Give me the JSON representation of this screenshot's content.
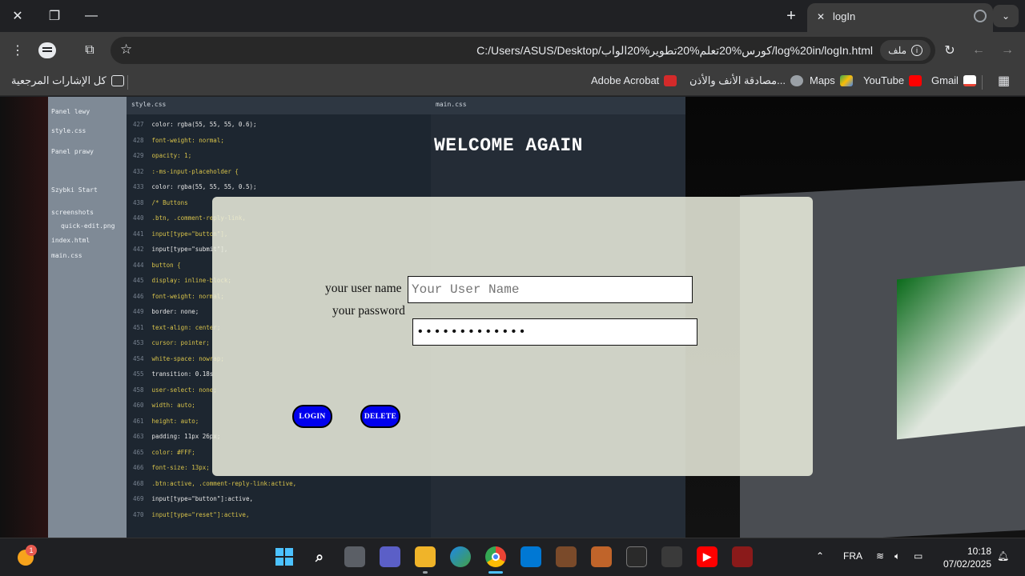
{
  "window": {
    "tab_title": "logIn",
    "new_tab_label": "+",
    "close_label": "✕",
    "maximize_label": "❐",
    "minimize_label": "—"
  },
  "toolbar": {
    "url": "C:/Users/ASUS/Desktop/كورس%20تعلم%20تطوير%20الواب/log%20in/logIn.html",
    "site_chip_label": "ملف"
  },
  "bookmarks": {
    "all_bookmarks": "كل الإشارات المرجعية",
    "items": [
      {
        "label": "Adobe Acrobat",
        "color": "#d42a2a"
      },
      {
        "label": "مصادقة الأنف والأذن...",
        "color": "#9aa0a6"
      },
      {
        "label": "Maps",
        "color": "#34a853"
      },
      {
        "label": "YouTube",
        "color": "#ff0000"
      },
      {
        "label": "Gmail",
        "color": "#ea4335"
      }
    ]
  },
  "page": {
    "heading": "WELCOME AGAIN",
    "username_label": "your user name",
    "username_placeholder": "Your User Name",
    "password_label": "your password",
    "password_value": "•••••••••••••",
    "login_button": "LOGIN",
    "delete_button": "DELETE",
    "accent_color": "#0000ee",
    "background_code": {
      "left_panel": [
        "Panel lewy",
        "style.css",
        "Panel prawy",
        "Szybki Start",
        "screenshots",
        "quick-edit.png",
        "index.html",
        "main.css"
      ],
      "file1_tab": "style.css",
      "file2_tab": "main.css",
      "lines": [
        {
          "n": "427",
          "t": "color: rgba(55, 55, 55, 0.6);"
        },
        {
          "n": "428",
          "t": "font-weight: normal;"
        },
        {
          "n": "429",
          "t": "opacity: 1;"
        },
        {
          "n": "432",
          "t": ":-ms-input-placeholder {"
        },
        {
          "n": "433",
          "t": "color: rgba(55, 55, 55, 0.5);"
        },
        {
          "n": "438",
          "t": "/* Buttons"
        },
        {
          "n": "440",
          "t": ".btn, .comment-reply-link,"
        },
        {
          "n": "441",
          "t": "input[type=\"button\"],"
        },
        {
          "n": "442",
          "t": "input[type=\"submit\"],"
        },
        {
          "n": "444",
          "t": "button {"
        },
        {
          "n": "445",
          "t": "display: inline-block;"
        },
        {
          "n": "446",
          "t": "font-weight: normal;"
        },
        {
          "n": "449",
          "t": "border: none;"
        },
        {
          "n": "451",
          "t": "text-align: center;"
        },
        {
          "n": "453",
          "t": "cursor: pointer;"
        },
        {
          "n": "454",
          "t": "white-space: nowrap;"
        },
        {
          "n": "455",
          "t": "transition: 0.18s"
        },
        {
          "n": "458",
          "t": "user-select: none;"
        },
        {
          "n": "460",
          "t": "width: auto;"
        },
        {
          "n": "461",
          "t": "height: auto;"
        },
        {
          "n": "463",
          "t": "padding: 11px 26px;"
        },
        {
          "n": "465",
          "t": "color: #FFF;"
        },
        {
          "n": "466",
          "t": "font-size: 13px;"
        },
        {
          "n": "468",
          "t": ".btn:active, .comment-reply-link:active,"
        },
        {
          "n": "469",
          "t": "input[type=\"button\"]:active,"
        },
        {
          "n": "470",
          "t": "input[type=\"reset\"]:active,"
        }
      ]
    }
  },
  "taskbar": {
    "notification_count": "1",
    "language": "FRA",
    "time": "10:18",
    "date": "07/02/2025"
  }
}
